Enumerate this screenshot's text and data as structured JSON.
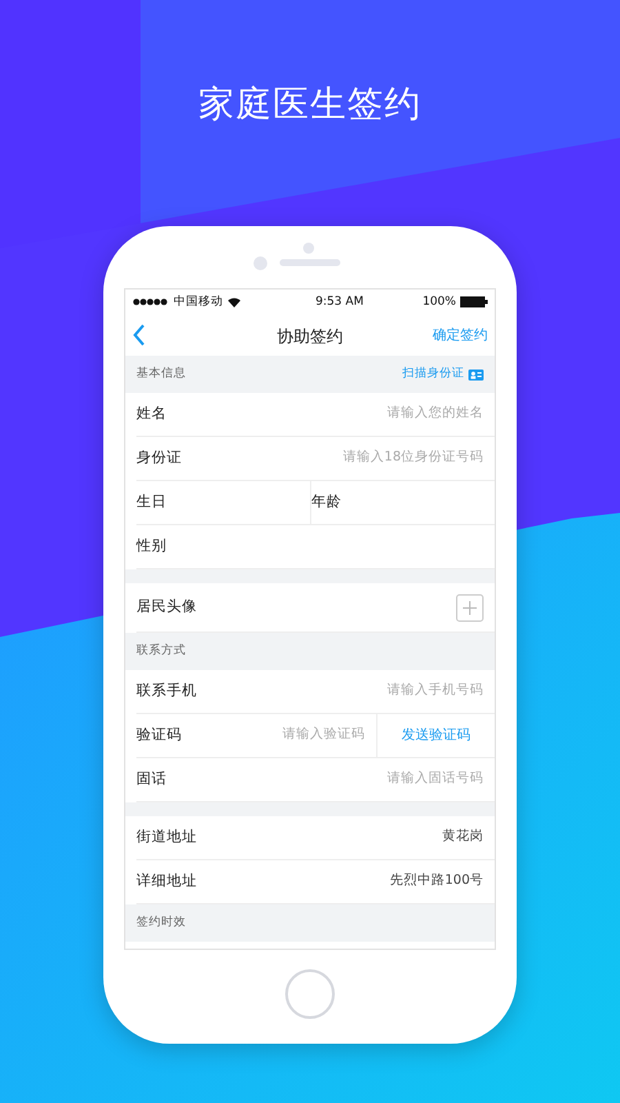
{
  "headline": "家庭医生签约",
  "status_bar": {
    "carrier": "中国移动",
    "time": "9:53 AM",
    "battery": "100%"
  },
  "nav": {
    "title": "协助签约",
    "action": "确定签约"
  },
  "sections": [
    {
      "title": "基本信息",
      "action": "扫描身份证",
      "rows": [
        {
          "kind": "input",
          "label": "姓名",
          "placeholder": "请输入您的姓名"
        },
        {
          "kind": "input",
          "label": "身份证",
          "placeholder": "请输入18位身份证号码"
        },
        {
          "kind": "pair",
          "label": "生日",
          "label_2": "年龄"
        },
        {
          "kind": "plain",
          "label": "性别"
        }
      ]
    },
    {
      "rows": [
        {
          "kind": "photo",
          "label": "居民头像"
        }
      ]
    },
    {
      "title": "联系方式",
      "rows": [
        {
          "kind": "input",
          "label": "联系手机",
          "placeholder": "请输入手机号码"
        },
        {
          "kind": "code",
          "label": "验证码",
          "placeholder": "请输入验证码",
          "button": "发送验证码"
        },
        {
          "kind": "input",
          "label": "固话",
          "placeholder": "请输入固话号码"
        }
      ]
    },
    {
      "rows": [
        {
          "kind": "value",
          "label": "街道地址",
          "value": "黄花岗"
        },
        {
          "kind": "value",
          "label": "详细地址",
          "value": "先烈中路100号"
        }
      ]
    },
    {
      "title": "签约时效"
    }
  ]
}
